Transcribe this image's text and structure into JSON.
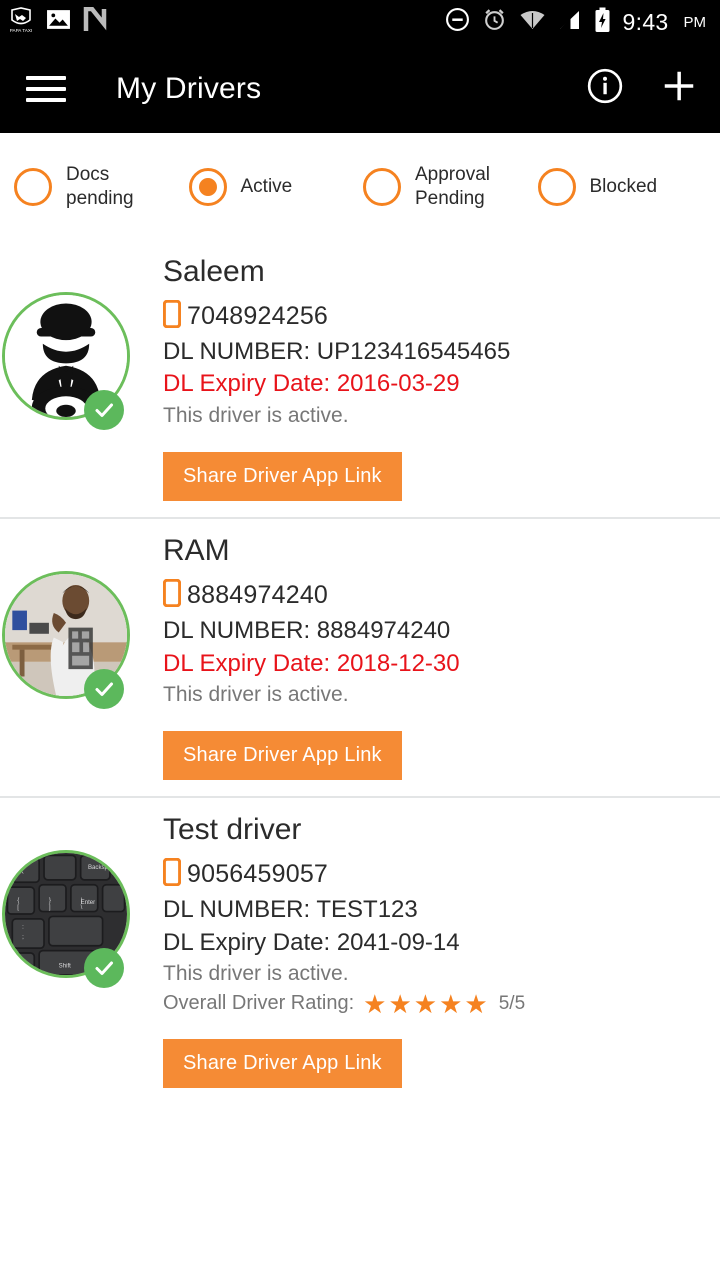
{
  "status_bar": {
    "time": "9:43",
    "ampm": "PM",
    "left_icons": [
      "app-handshake-icon",
      "gallery-image-icon",
      "letter-n-app-icon"
    ],
    "right_icons": [
      "do-not-disturb-icon",
      "alarm-icon",
      "wifi-icon",
      "cellular-signal-icon",
      "battery-charging-icon"
    ]
  },
  "toolbar": {
    "menu_icon": "hamburger-menu-icon",
    "title": "My Drivers",
    "info_icon": "info-icon",
    "add_icon": "plus-icon"
  },
  "filters": {
    "options": [
      {
        "label": "Docs pending",
        "selected": false
      },
      {
        "label": "Active",
        "selected": true
      },
      {
        "label": "Approval Pending",
        "selected": false
      },
      {
        "label": "Blocked",
        "selected": false
      }
    ]
  },
  "colors": {
    "accent_orange": "#F58220",
    "button_orange": "#F58B35",
    "expired_red": "#E8131A",
    "verified_green": "#5CB85C",
    "avatar_ring_green": "#6CBE5B",
    "toolbar_black": "#000000",
    "muted_gray": "#777777"
  },
  "labels": {
    "dl_number_prefix": "DL NUMBER:",
    "dl_expiry_prefix": "DL Expiry Date:",
    "rating_prefix": "Overall Driver Rating:",
    "share_button": "Share Driver App Link",
    "phone_icon": "mobile-phone-icon",
    "verified_icon": "verified-check-icon"
  },
  "drivers": [
    {
      "name": "Saleem",
      "phone": "7048924256",
      "dl_number": "DL NUMBER: UP123416545465",
      "dl_expiry": "DL Expiry Date: 2016-03-29",
      "dl_expired": true,
      "status": "This driver is active.",
      "avatar_type": "chauffeur-placeholder-icon",
      "verified": true,
      "share_label": "Share Driver App Link",
      "rating": null
    },
    {
      "name": "RAM",
      "phone": "8884974240",
      "dl_number": "DL NUMBER: 8884974240",
      "dl_expiry": "DL Expiry Date: 2018-12-30",
      "dl_expired": true,
      "status": "This driver is active.",
      "avatar_type": "driver-photo-person",
      "verified": true,
      "share_label": "Share Driver App Link",
      "rating": null
    },
    {
      "name": "Test driver",
      "phone": "9056459057",
      "dl_number": "DL NUMBER: TEST123",
      "dl_expiry": "DL Expiry Date: 2041-09-14",
      "dl_expired": false,
      "status": "This driver is active.",
      "avatar_type": "driver-photo-keyboard",
      "verified": true,
      "share_label": "Share Driver App Link",
      "rating": {
        "label": "Overall Driver Rating:",
        "stars": "★★★★★",
        "value": "5/5"
      }
    }
  ]
}
